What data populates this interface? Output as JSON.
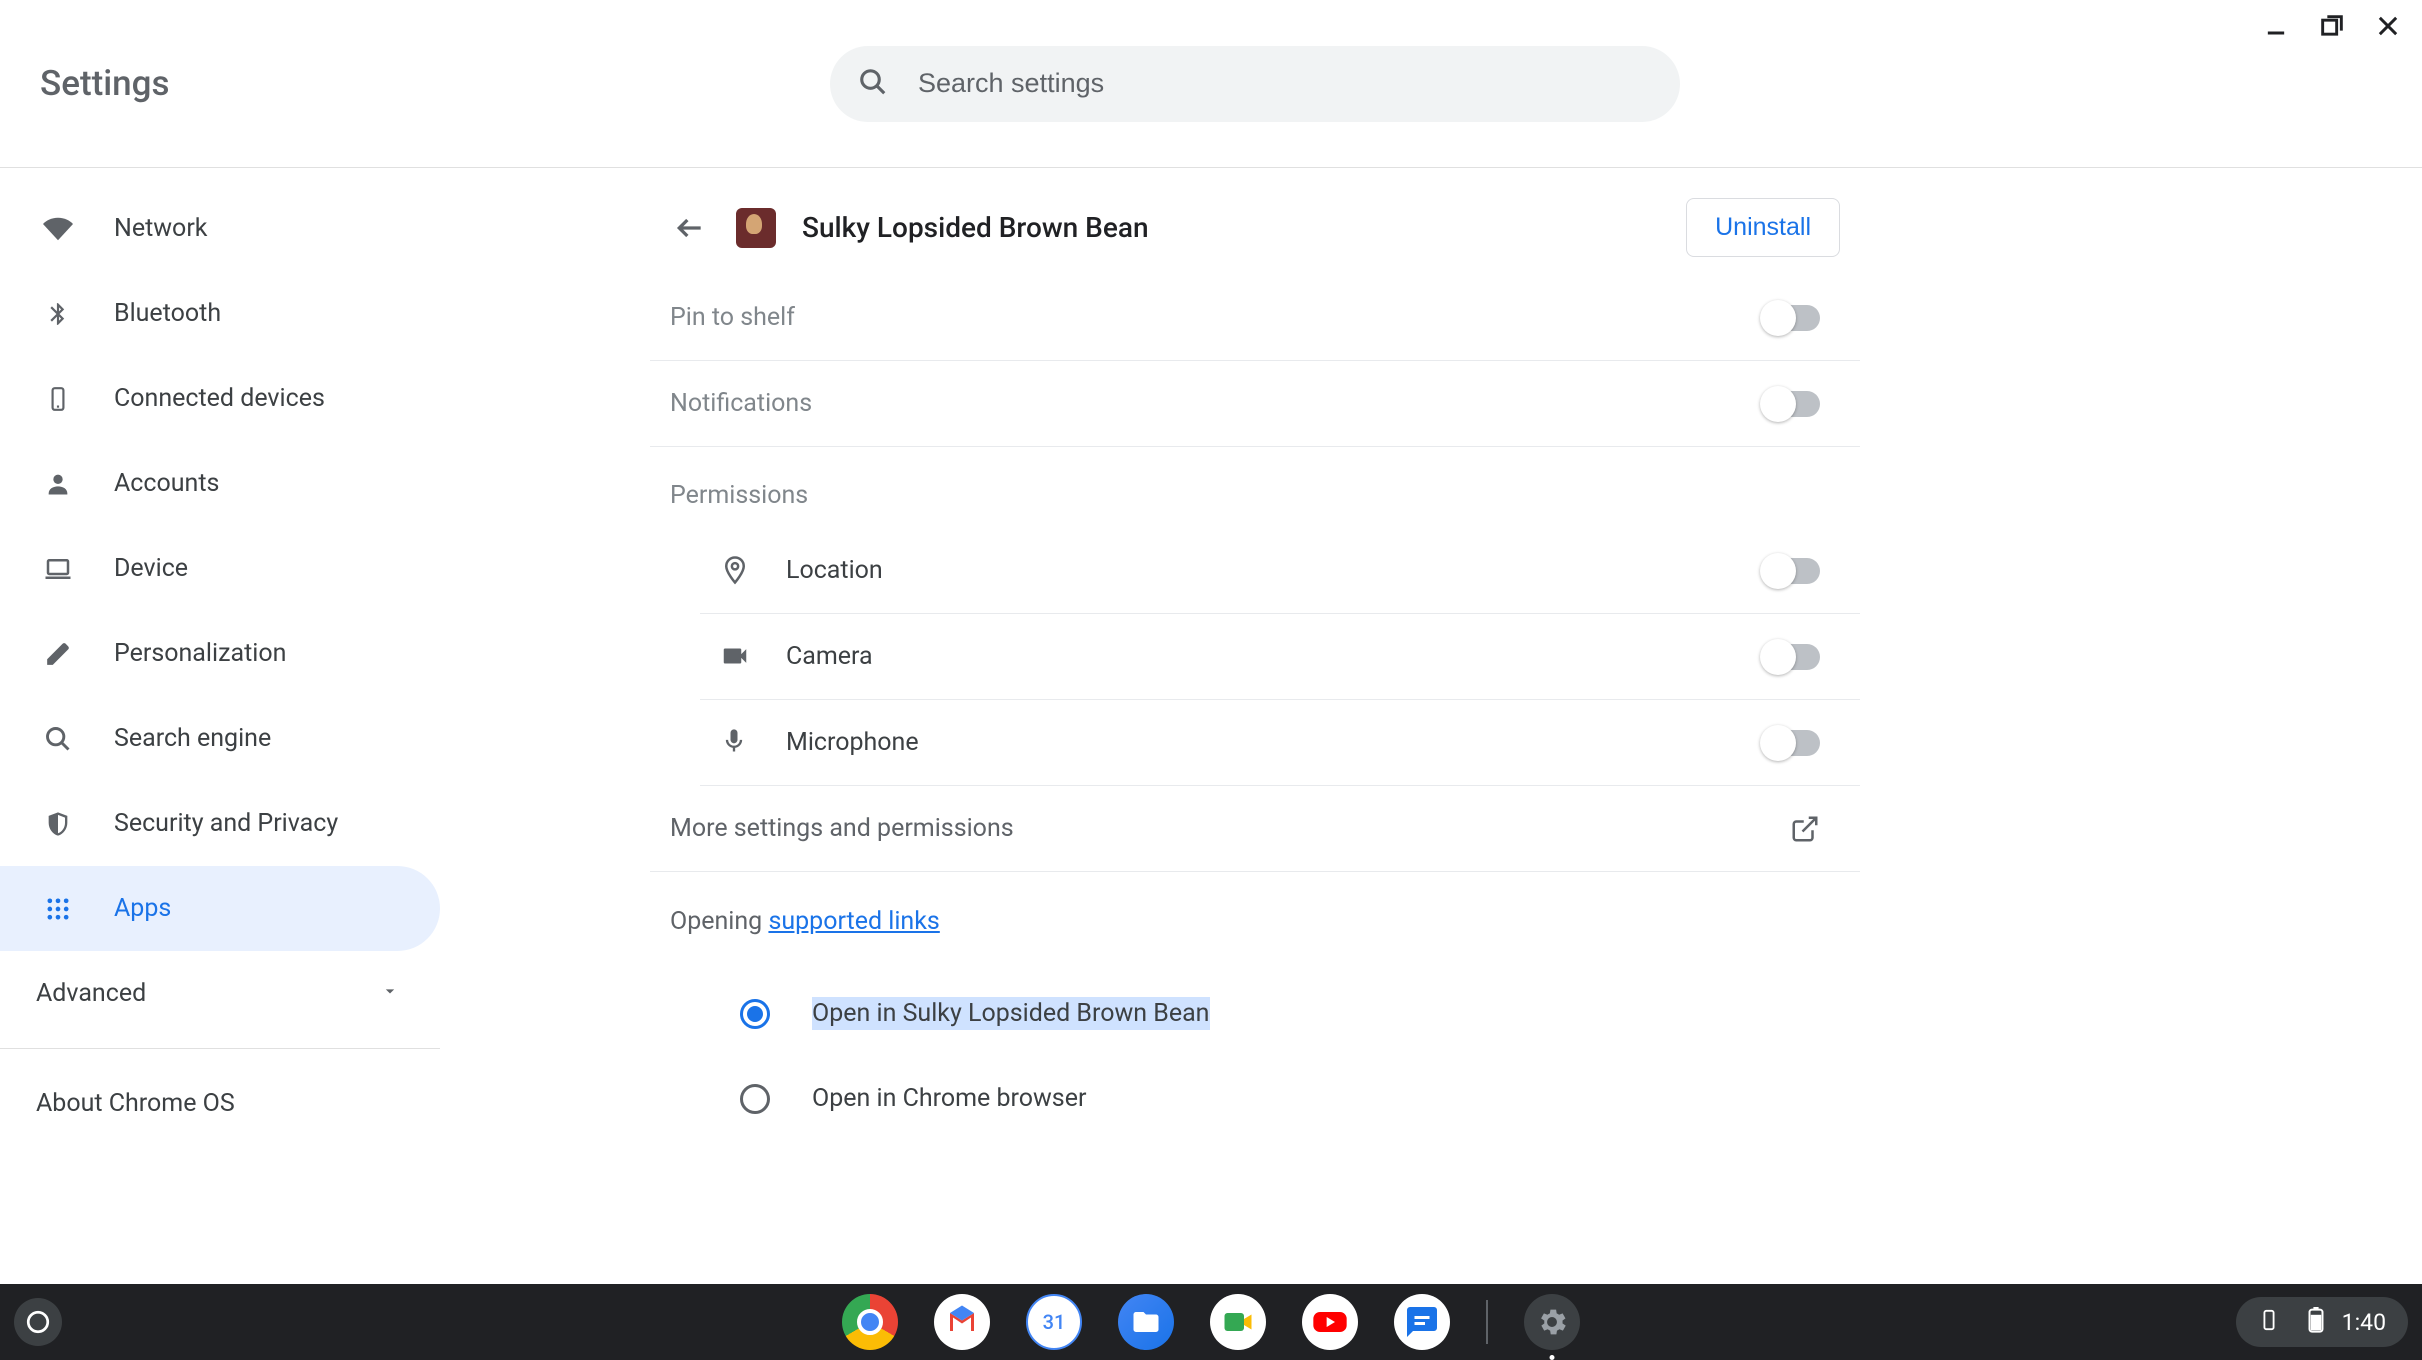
{
  "window": {
    "title": "Settings",
    "search_placeholder": "Search settings"
  },
  "sidebar": {
    "items": [
      {
        "id": "network",
        "label": "Network"
      },
      {
        "id": "bluetooth",
        "label": "Bluetooth"
      },
      {
        "id": "connected-devices",
        "label": "Connected devices"
      },
      {
        "id": "accounts",
        "label": "Accounts"
      },
      {
        "id": "device",
        "label": "Device"
      },
      {
        "id": "personalization",
        "label": "Personalization"
      },
      {
        "id": "search-engine",
        "label": "Search engine"
      },
      {
        "id": "security-privacy",
        "label": "Security and Privacy"
      },
      {
        "id": "apps",
        "label": "Apps",
        "selected": true
      }
    ],
    "advanced_label": "Advanced",
    "about_label": "About Chrome OS"
  },
  "app_detail": {
    "name": "Sulky Lopsided Brown Bean",
    "uninstall_label": "Uninstall",
    "pin_to_shelf_label": "Pin to shelf",
    "pin_to_shelf": false,
    "notifications_label": "Notifications",
    "notifications": false,
    "permissions_title": "Permissions",
    "permissions": [
      {
        "id": "location",
        "label": "Location",
        "enabled": false
      },
      {
        "id": "camera",
        "label": "Camera",
        "enabled": false
      },
      {
        "id": "microphone",
        "label": "Microphone",
        "enabled": false
      }
    ],
    "more_settings_label": "More settings and permissions",
    "opening_prefix": "Opening ",
    "opening_link": "supported links",
    "open_options": [
      {
        "id": "open-app",
        "label": "Open in Sulky Lopsided Brown Bean",
        "selected": true
      },
      {
        "id": "open-chrome",
        "label": "Open in Chrome browser",
        "selected": false
      }
    ]
  },
  "shelf": {
    "time": "1:40"
  }
}
